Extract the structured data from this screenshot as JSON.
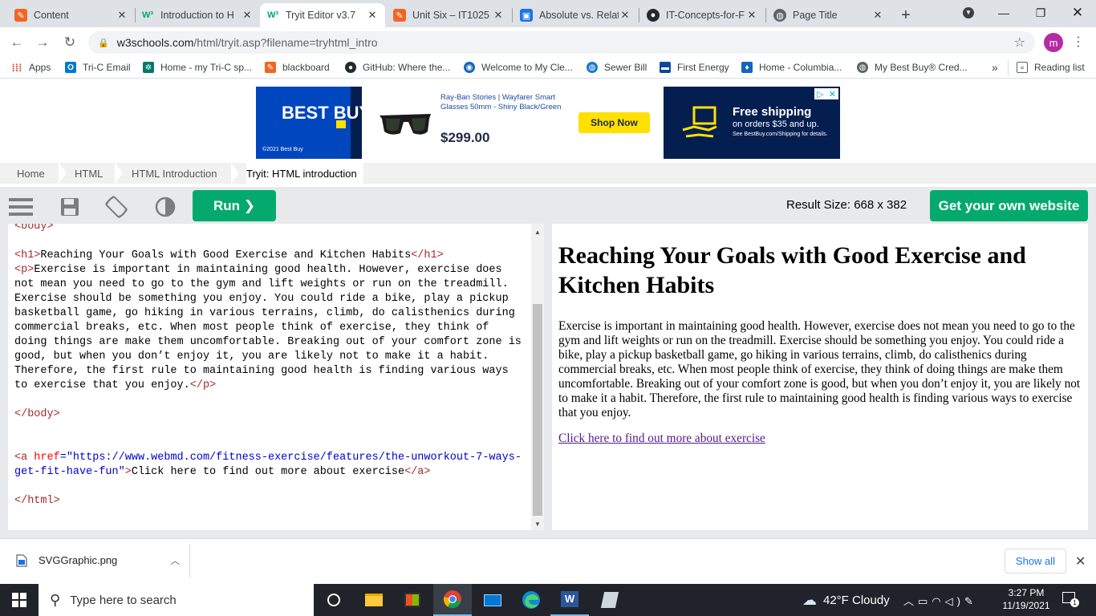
{
  "browser": {
    "tabs": [
      {
        "title": "Content",
        "icon": "content-tab-icon",
        "color": "#f26522"
      },
      {
        "title": "Introduction to H",
        "icon": "w3-icon",
        "color": "#04aa6d"
      },
      {
        "title": "Tryit Editor v3.7",
        "icon": "w3-icon",
        "color": "#04aa6d",
        "active": true
      },
      {
        "title": "Unit Six – IT1025",
        "icon": "unit-six-icon",
        "color": "#f26522"
      },
      {
        "title": "Absolute vs. Relat",
        "icon": "doc-icon",
        "color": "#1a73e8"
      },
      {
        "title": "IT-Concepts-for-F",
        "icon": "github-icon",
        "color": "#24292e"
      },
      {
        "title": "Page Title",
        "icon": "globe-icon",
        "color": "#5f6368"
      }
    ],
    "new_tab": "+",
    "url_host": "w3schools.com",
    "url_path": "/html/tryit.asp?filename=tryhtml_intro",
    "profile_initial": "m",
    "bookmarks": [
      {
        "label": "Apps",
        "icon": "apps-grid-icon",
        "color": "#ea4335"
      },
      {
        "label": "Tri-C Email",
        "icon": "outlook-icon",
        "color": "#0078d4"
      },
      {
        "label": "Home - my Tri-C sp...",
        "icon": "tri-c-icon",
        "color": "#00796b"
      },
      {
        "label": "blackboard",
        "icon": "blackboard-icon",
        "color": "#f26522"
      },
      {
        "label": "GitHub: Where the...",
        "icon": "github-icon",
        "color": "#24292e"
      },
      {
        "label": "Welcome to My Cle...",
        "icon": "cle-icon",
        "color": "#1565c0"
      },
      {
        "label": "Sewer Bill",
        "icon": "sewer-icon",
        "color": "#1976d2"
      },
      {
        "label": "First Energy",
        "icon": "first-energy-icon",
        "color": "#0d47a1"
      },
      {
        "label": "Home - Columbia...",
        "icon": "columbia-icon",
        "color": "#1565c0"
      },
      {
        "label": "My Best Buy® Cred...",
        "icon": "globe-icon",
        "color": "#5f6368"
      }
    ],
    "more": "»",
    "reading_list": "Reading list"
  },
  "ad": {
    "brand": "BEST BUY",
    "copyright": "©2021 Best Buy",
    "product_title": "Ray-Ban Stories | Wayfarer Smart Glasses 50mm - Shiny Black/Green",
    "price": "$299.00",
    "shop_button": "Shop Now",
    "free_shipping": "Free shipping",
    "free_shipping_sub": "on orders $35 and up.",
    "free_shipping_fine": "See BestBuy.com/Shipping for details."
  },
  "breadcrumb": [
    "Home",
    "HTML",
    "HTML Introduction",
    "Tryit: HTML introduction"
  ],
  "tryit": {
    "run_label": "Run ❯",
    "result_size": "Result Size: 668 x 382",
    "get_website": "Get your own website"
  },
  "code": {
    "line_body_open_partial": "<body>",
    "h1_open": "<h1>",
    "h1_text": "Reaching Your Goals with Good Exercise and Kitchen Habits",
    "h1_close": "</h1>",
    "p_open": "<p>",
    "p_text": "Exercise is important in maintaining good health. However, exercise does not mean you need to go to the gym and lift weights or run on the treadmill. Exercise should be something you enjoy. You could ride a bike, play a pickup basketball game, go hiking in various terrains, climb, do calisthenics during commercial breaks, etc. When most people think of exercise, they think of doing things are make them uncomfortable. Breaking out of your comfort zone is good, but when you don’t enjoy it, you are likely not to make it a habit. Therefore, the first rule to maintaining good health is finding various ways to exercise that you enjoy.",
    "p_close": "</p>",
    "body_close": "</body>",
    "a_open_tag": "<a",
    "a_attr": " href",
    "a_eq": "=",
    "a_value": "\"https://www.webmd.com/fitness-exercise/features/the-unworkout-7-ways-get-fit-have-fun\"",
    "a_gt": ">",
    "a_text": "Click here to find out more about exercise",
    "a_close": "</a>",
    "html_close": "</html>"
  },
  "result": {
    "heading": "Reaching Your Goals with Good Exercise and Kitchen Habits",
    "paragraph": "Exercise is important in maintaining good health. However, exercise does not mean you need to go to the gym and lift weights or run on the treadmill. Exercise should be something you enjoy. You could ride a bike, play a pickup basketball game, go hiking in various terrains, climb, do calisthenics during commercial breaks, etc. When most people think of exercise, they think of doing things are make them uncomfortable. Breaking out of your comfort zone is good, but when you don’t enjoy it, you are likely not to make it a habit. Therefore, the first rule to maintaining good health is finding various ways to exercise that you enjoy.",
    "link": "Click here to find out more about exercise"
  },
  "downloads": {
    "file": "SVGGraphic.png",
    "show_all": "Show all"
  },
  "taskbar": {
    "search_placeholder": "Type here to search",
    "weather": "42°F  Cloudy",
    "time": "3:27 PM",
    "date": "11/19/2021",
    "notifications": "1"
  }
}
